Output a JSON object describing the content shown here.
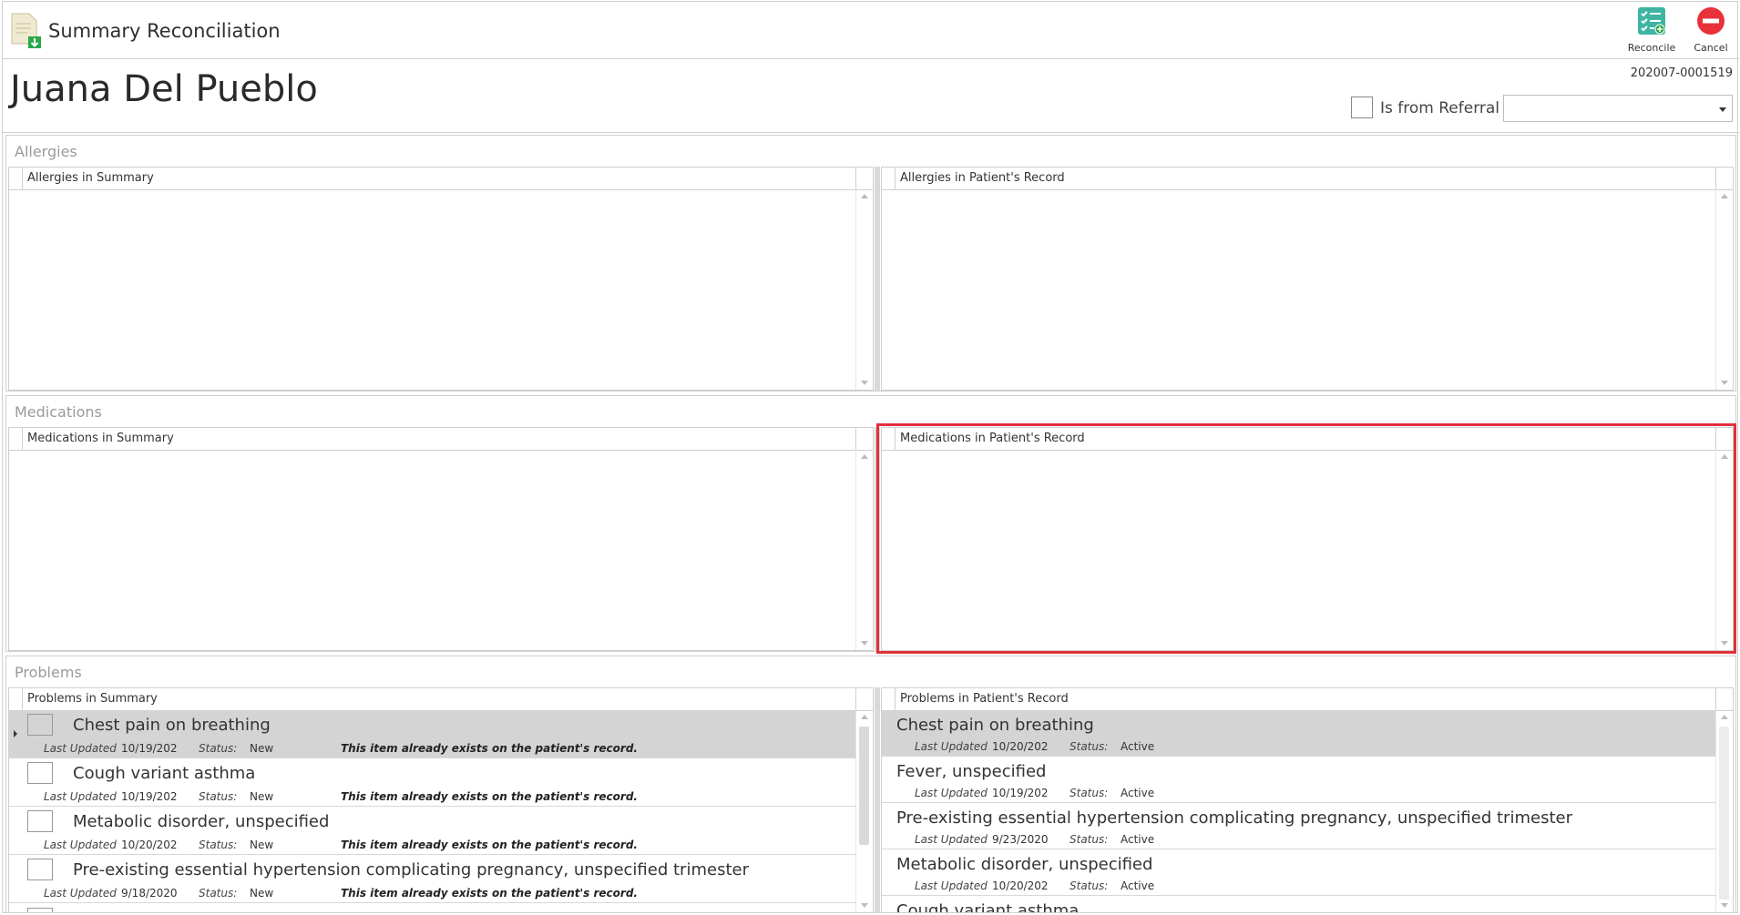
{
  "app": {
    "title": "Summary Reconciliation"
  },
  "toolbar": {
    "reconcile_label": "Reconcile",
    "cancel_label": "Cancel"
  },
  "patient": {
    "name": "Juana Del Pueblo",
    "record_id": "202007-0001519",
    "referral_label": "Is from Referral",
    "referral_value": ""
  },
  "allergies": {
    "section_title": "Allergies",
    "summary_header": "Allergies in Summary",
    "record_header": "Allergies in Patient's Record"
  },
  "medications": {
    "section_title": "Medications",
    "summary_header": "Medications in Summary",
    "record_header": "Medications in Patient's Record"
  },
  "problems": {
    "section_title": "Problems",
    "summary_header": "Problems in Summary",
    "record_header": "Problems in Patient's Record",
    "labels": {
      "last_updated": "Last Updated",
      "status": "Status:"
    },
    "summary_items": [
      {
        "name": "Chest pain on breathing",
        "last_updated": "10/19/202",
        "status": "New",
        "note": "This item already exists on the patient's record."
      },
      {
        "name": "Cough variant asthma",
        "last_updated": "10/19/202",
        "status": "New",
        "note": "This item already exists on the patient's record."
      },
      {
        "name": "Metabolic disorder, unspecified",
        "last_updated": "10/20/202",
        "status": "New",
        "note": "This item already exists on the patient's record."
      },
      {
        "name": "Pre-existing essential hypertension complicating pregnancy, unspecified trimester",
        "last_updated": "9/18/2020",
        "status": "New",
        "note": "This item already exists on the patient's record."
      }
    ],
    "record_items": [
      {
        "name": "Chest pain on breathing",
        "last_updated": "10/20/202",
        "status": "Active"
      },
      {
        "name": "Fever, unspecified",
        "last_updated": "10/19/202",
        "status": "Active"
      },
      {
        "name": "Pre-existing essential hypertension complicating pregnancy, unspecified trimester",
        "last_updated": "9/23/2020",
        "status": "Active"
      },
      {
        "name": "Metabolic disorder, unspecified",
        "last_updated": "10/20/202",
        "status": "Active"
      },
      {
        "name": "Cough variant asthma",
        "last_updated": "",
        "status": ""
      }
    ]
  },
  "colors": {
    "highlight": "#e0303a",
    "selected_row": "#d4d4d4",
    "section_title": "#9a9a9a"
  }
}
